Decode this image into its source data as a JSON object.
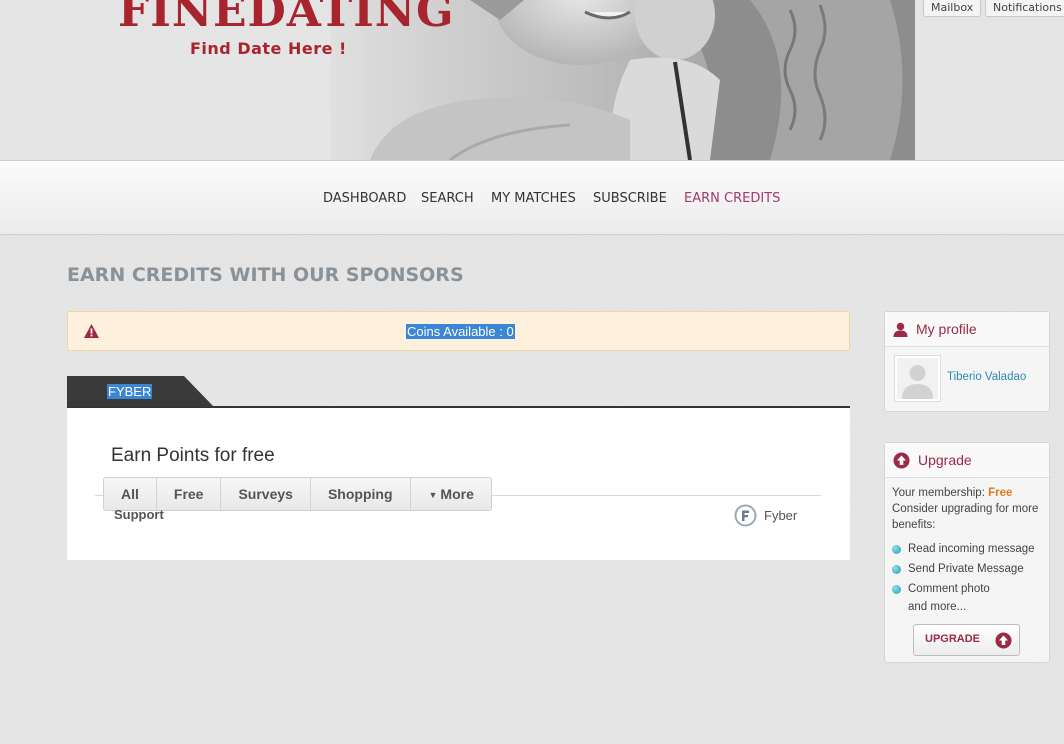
{
  "brand": {
    "name": "FINEDATING",
    "tagline": "Find Date Here !"
  },
  "topbar": {
    "mailbox": "Mailbox",
    "notifications": "Notifications"
  },
  "nav": {
    "items": [
      {
        "label": "DASHBOARD"
      },
      {
        "label": "SEARCH"
      },
      {
        "label": "MY MATCHES"
      },
      {
        "label": "SUBSCRIBE"
      },
      {
        "label": "EARN CREDITS",
        "active": true
      }
    ]
  },
  "main": {
    "title": "EARN CREDITS WITH OUR SPONSORS",
    "alert": "Coins Available : 0",
    "tab": "FYBER",
    "offer_wall": {
      "title": "Earn Points for free",
      "filters": [
        "All",
        "Free",
        "Surveys",
        "Shopping",
        "More"
      ],
      "support": "Support",
      "provider": "Fyber"
    }
  },
  "sidebar": {
    "profile": {
      "title": "My profile",
      "name": "Tiberio Valadao"
    },
    "upgrade": {
      "title": "Upgrade",
      "membership_label": "Your membership:",
      "plan": "Free",
      "note": "Consider upgrading for more benefits:",
      "benefits": [
        "Read incoming message",
        "Send Private Message",
        "Comment photo"
      ],
      "and_more": "and more...",
      "button": "UPGRADE"
    }
  },
  "colors": {
    "brand": "#a8242e",
    "accent": "#9a2a45",
    "link": "#2a8bb0",
    "selection": "#3a86d4"
  }
}
